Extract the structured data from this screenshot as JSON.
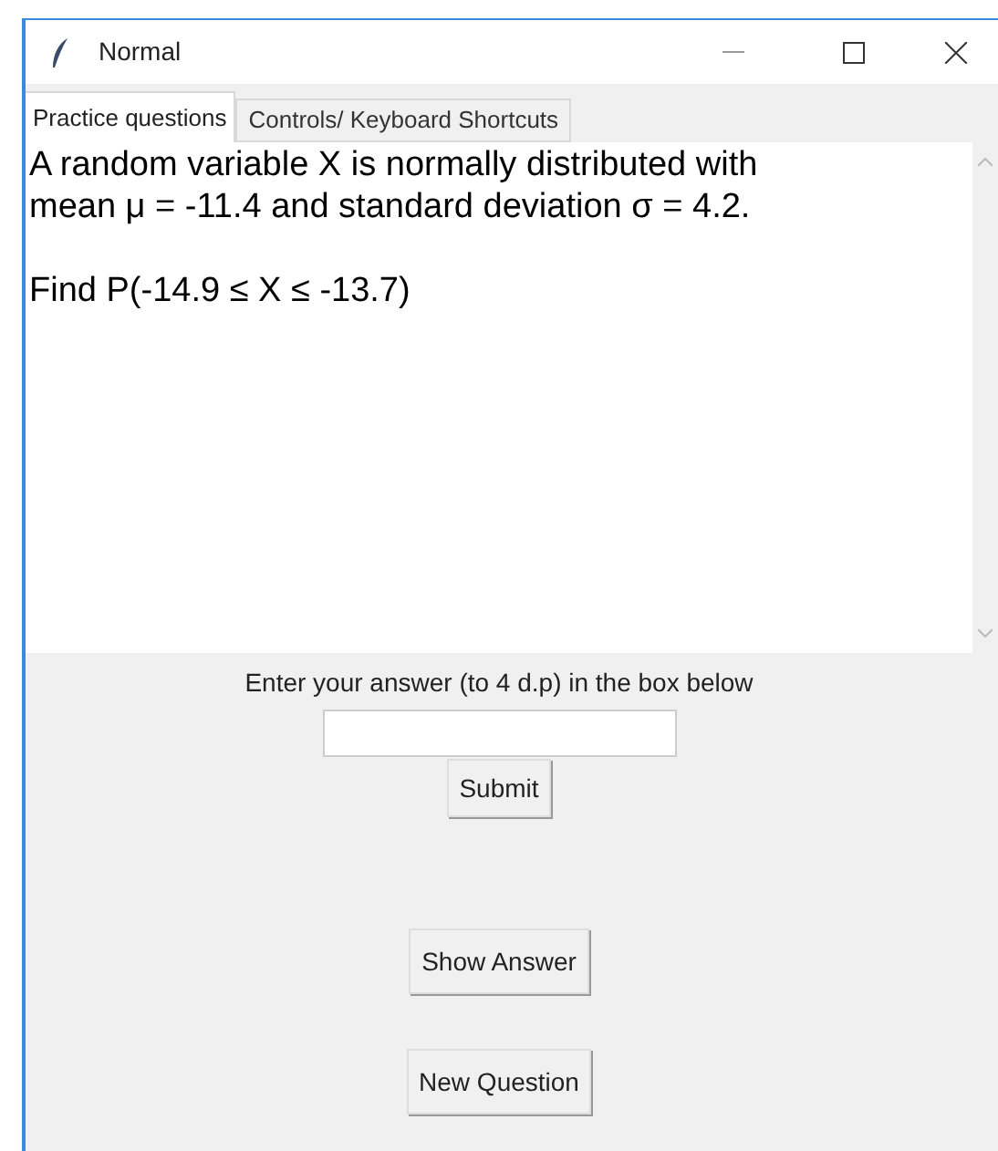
{
  "window": {
    "title": "Normal"
  },
  "tabs": [
    {
      "label": "Practice questions",
      "selected": true
    },
    {
      "label": "Controls/ Keyboard Shortcuts",
      "selected": false
    }
  ],
  "question": {
    "paragraphs": [
      [
        "A random variable X is normally distributed with",
        "mean μ = -11.4 and standard deviation σ = 4.2."
      ],
      [
        "Find P(-14.9 ≤ X ≤ -13.7)"
      ]
    ]
  },
  "answer": {
    "prompt": "Enter your answer (to 4 d.p) in the box below",
    "submit": "Submit"
  },
  "buttons": [
    "Show Answer",
    "New Question"
  ]
}
